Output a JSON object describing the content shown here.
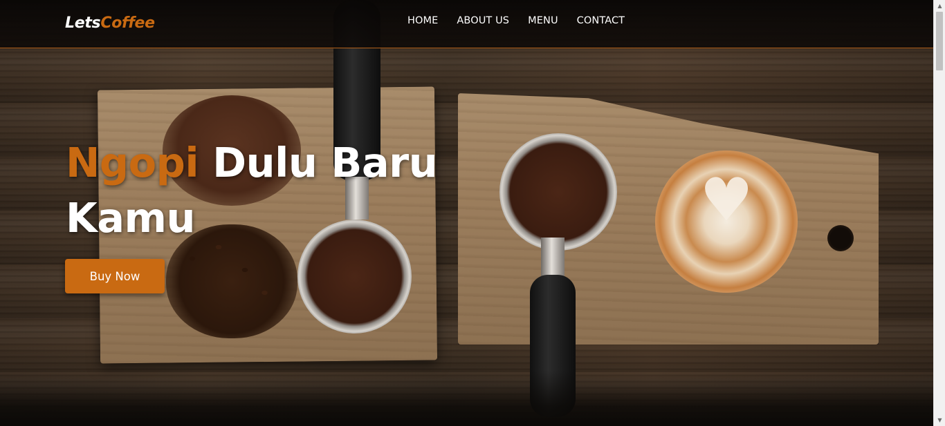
{
  "brand": {
    "logo_part_1": "Lets",
    "logo_part_2": "Coffee",
    "accent_color": "#c96a12"
  },
  "nav": {
    "items": [
      {
        "label": "HOME"
      },
      {
        "label": "ABOUT US"
      },
      {
        "label": "MENU"
      },
      {
        "label": "CONTACT"
      }
    ]
  },
  "hero": {
    "headline_accent": "Ngopi",
    "headline_rest": "Dulu Baru Kamu",
    "cta_label": "Buy Now",
    "background_image": "coffee-beans-portafilters-latte-on-wooden-boards"
  },
  "icons": {
    "scroll_up": "scroll-up-arrow-icon",
    "scroll_down": "scroll-down-arrow-icon",
    "latte_art": "heart-latte-art"
  }
}
